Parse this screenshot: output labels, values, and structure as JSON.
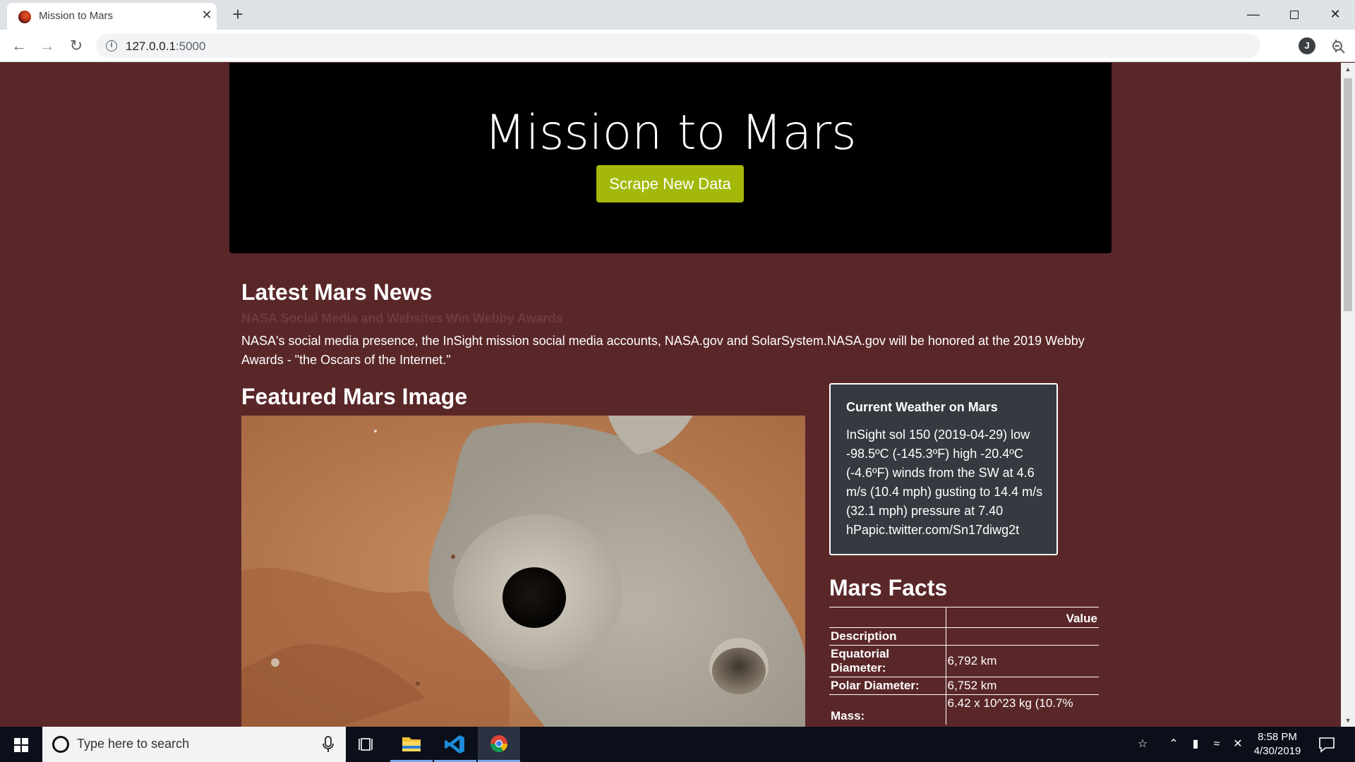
{
  "browser": {
    "tab_title": "Mission to Mars",
    "tab_close": "✕",
    "new_tab": "+",
    "url_host": "127.0.0.1",
    "url_port": ":5000",
    "profile_initial": "J"
  },
  "page": {
    "title": "Mission to Mars",
    "scrape_button": "Scrape New Data",
    "news": {
      "heading": "Latest Mars News",
      "headline": "NASA Social Media and Websites Win Webby Awards",
      "body": "NASA's social media presence, the InSight mission social media accounts, NASA.gov and SolarSystem.NASA.gov will be honored at the 2019 Webby Awards - \"the Oscars of the Internet.\""
    },
    "featured": {
      "heading": "Featured Mars Image"
    },
    "weather": {
      "title": "Current Weather on Mars",
      "text": "InSight sol 150 (2019-04-29) low -98.5ºC (-145.3ºF) high -20.4ºC (-4.6ºF) winds from the SW at 4.6 m/s (10.4 mph) gusting to 14.4 m/s (32.1 mph) pressure at 7.40 hPapic.twitter.com/Sn17diwg2t"
    },
    "facts": {
      "heading": "Mars Facts",
      "value_header": "Value",
      "rows": [
        {
          "label": "Description",
          "value": ""
        },
        {
          "label": "Equatorial Diameter:",
          "value": "6,792 km"
        },
        {
          "label": "Polar Diameter:",
          "value": "6,752 km"
        },
        {
          "label": "Mass:",
          "value": "6.42 x 10^23 kg (10.7%"
        }
      ]
    }
  },
  "taskbar": {
    "search_placeholder": "Type here to search",
    "time": "8:58 PM",
    "date": "4/30/2019"
  },
  "colors": {
    "page_background": "#5a2729",
    "jumbotron": "#000000",
    "button": "#a4b80a",
    "weather_card": "#343a40"
  }
}
